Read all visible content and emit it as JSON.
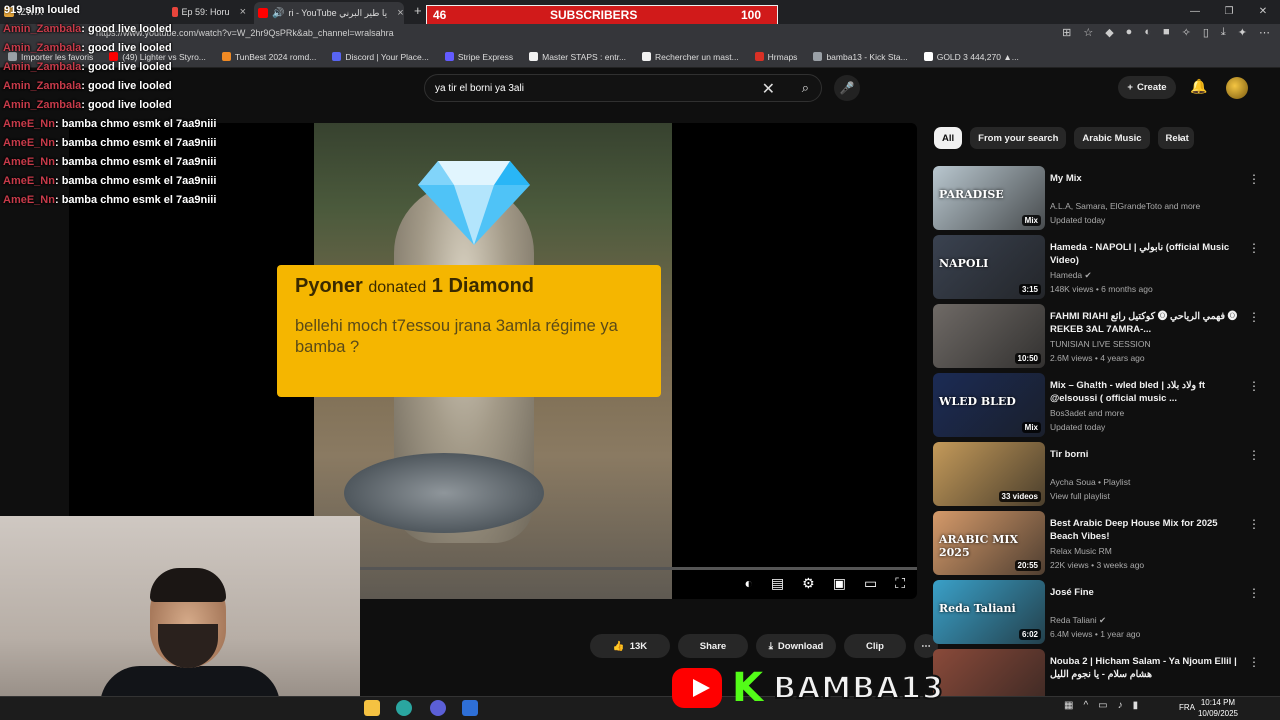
{
  "browser": {
    "tabs": [
      {
        "label": "IZWIX",
        "color": "#e2a33a"
      },
      {
        "label": "Ep 59: Horu",
        "color": "#e8453c"
      },
      {
        "label": "ri - YouTube يا طير البرني",
        "color": "#ff0000"
      }
    ],
    "url": "https://www.youtube.com/watch?v=W_2hr9QsPRk&ab_channel=wralsahra",
    "bookmarks": [
      {
        "label": "Importer les favoris",
        "color": "#9aa0a6"
      },
      {
        "label": "(49) Lighter vs Styro...",
        "color": "#ff0000"
      },
      {
        "label": "TunBest 2024 romd...",
        "color": "#f08a24"
      },
      {
        "label": "Discord | Your Place...",
        "color": "#5865f2"
      },
      {
        "label": "Stripe Express",
        "color": "#635bff"
      },
      {
        "label": "Master STAPS : entr...",
        "color": "#f1f1f1"
      },
      {
        "label": "Rechercher un mast...",
        "color": "#f1f1f1"
      },
      {
        "label": "Hrmaps",
        "color": "#d93025"
      },
      {
        "label": "bamba13 - Kick Sta...",
        "color": "#9aa0a6"
      },
      {
        "label": "GOLD 3 444,270 ▲...",
        "color": "#ffffff"
      }
    ]
  },
  "subscriber_goal": {
    "current": "46",
    "label": "SUBSCRIBERS",
    "target": "100",
    "color": "#d11a1a"
  },
  "chat": [
    {
      "user": "Amin_Zambala",
      "msg": ": good live looled"
    },
    {
      "user": "Amin_Zambala",
      "msg": ": good live looled"
    },
    {
      "user": "Amin_Zambala",
      "msg": ": good live looled"
    },
    {
      "user": "Amin_Zambala",
      "msg": ": good live looled"
    },
    {
      "user": "Amin_Zambala",
      "msg": ": good live looled"
    },
    {
      "user": "AmeE_Nn",
      "msg": ": bamba chmo esmk el 7aa9niii"
    },
    {
      "user": "AmeE_Nn",
      "msg": ": bamba chmo esmk el 7aa9niii"
    },
    {
      "user": "AmeE_Nn",
      "msg": ": bamba chmo esmk el 7aa9niii"
    },
    {
      "user": "AmeE_Nn",
      "msg": ": bamba chmo esmk el 7aa9niii"
    },
    {
      "user": "AmeE_Nn",
      "msg": ": bamba chmo esmk el 7aa9niii"
    }
  ],
  "chat_top": {
    "counter": "919",
    "text": "slm louled"
  },
  "youtube": {
    "search_query": "ya tir el borni ya 3ali",
    "create_label": "Create",
    "chips": [
      "All",
      "From your search",
      "Arabic Music",
      "Relat"
    ],
    "actions": {
      "likes": "13K",
      "share": "Share",
      "download": "Download",
      "clip": "Clip"
    }
  },
  "donation": {
    "user": "Pyoner",
    "verb": "donated",
    "amount": "1 Diamond",
    "message": "bellehi moch t7essou jrana 3amla régime ya bamba ?"
  },
  "recommendations": [
    {
      "title": "My Mix",
      "line1": "A.L.A, Samara, ElGrandeToto and more",
      "line2": "Updated today",
      "duration": "Mix",
      "thumb": "#b9c7cf",
      "thumb_text": "PARADISE"
    },
    {
      "title": "Hameda - NAPOLI | نابولي (official Music Video)",
      "line1": "Hameda ✔",
      "line2": "148K views • 6 months ago",
      "duration": "3:15",
      "thumb": "#3a4250",
      "thumb_text": "NAPOLI"
    },
    {
      "title": "FAHMI RIAHI كوكتيل رائع 🅞 فهمي الرياحي 🅞 REKEB 3AL 7AMRA-...",
      "line1": "TUNISIAN LIVE SESSION",
      "line2": "2.6M views • 4 years ago",
      "duration": "10:50",
      "thumb": "#6f6a66",
      "thumb_text": ""
    },
    {
      "title": "Mix – Gha!th - wled bled | ولاد بلاد ft @elsoussi ( official music ...",
      "line1": "Bos3adet and more",
      "line2": "Updated today",
      "duration": "Mix",
      "thumb": "#1b2b55",
      "thumb_text": "WLED BLED"
    },
    {
      "title": "Tir borni",
      "line1": "Aycha Soua • Playlist",
      "line2": "View full playlist",
      "duration": "33 videos",
      "thumb": "#c49a5a",
      "thumb_text": ""
    },
    {
      "title": "Best Arabic Deep House Mix for 2025 Beach Vibes!",
      "line1": "Relax Music RM",
      "line2": "22K views • 3 weeks ago",
      "duration": "20:55",
      "thumb": "#d59a6a",
      "thumb_text": "ARABIC MIX 2025"
    },
    {
      "title": "José Fine",
      "line1": "Reda Taliani ✔",
      "line2": "6.4M views • 1 year ago",
      "duration": "6:02",
      "thumb": "#3aa0c8",
      "thumb_text": "Reda Taliani"
    },
    {
      "title": "Nouba 2 | Hicham Salam - Ya Njoum Ellil | هشام سلام - يا نجوم الليل",
      "line1": "",
      "line2": "",
      "duration": "",
      "thumb": "#8a4a3a",
      "thumb_text": ""
    }
  ],
  "kick_banner": {
    "name": "BAMBA13",
    "k": "K"
  },
  "taskbar": {
    "time": "10:14 PM",
    "date": "10/09/2025",
    "lang": "FRA"
  }
}
